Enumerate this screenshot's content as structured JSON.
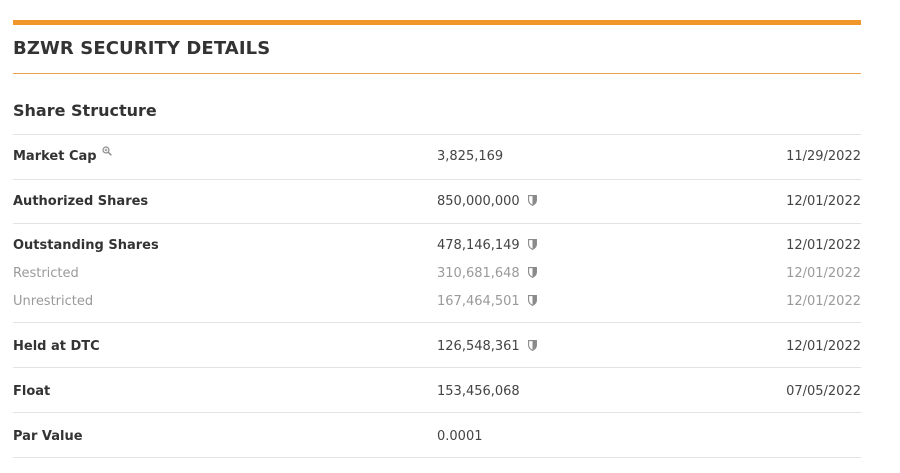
{
  "header": {
    "title": "BZWR SECURITY DETAILS"
  },
  "section": {
    "title": "Share Structure"
  },
  "rows": {
    "market_cap": {
      "label": "Market Cap",
      "value": "3,825,169",
      "date": "11/29/2022"
    },
    "authorized_shares": {
      "label": "Authorized Shares",
      "value": "850,000,000",
      "date": "12/01/2022"
    },
    "outstanding_shares": {
      "label": "Outstanding Shares",
      "value": "478,146,149",
      "date": "12/01/2022"
    },
    "restricted": {
      "label": "Restricted",
      "value": "310,681,648",
      "date": "12/01/2022"
    },
    "unrestricted": {
      "label": "Unrestricted",
      "value": "167,464,501",
      "date": "12/01/2022"
    },
    "held_at_dtc": {
      "label": "Held at DTC",
      "value": "126,548,361",
      "date": "12/01/2022"
    },
    "float": {
      "label": "Float",
      "value": "153,456,068",
      "date": "07/05/2022"
    },
    "par_value": {
      "label": "Par Value",
      "value": "0.0001",
      "date": ""
    }
  },
  "colors": {
    "accent": "#f0962a",
    "muted_text": "#9a9a9a",
    "divider": "#e3e3e3"
  },
  "icons": {
    "market_cap_info": "magnifier-icon",
    "verified": "shield-icon"
  }
}
